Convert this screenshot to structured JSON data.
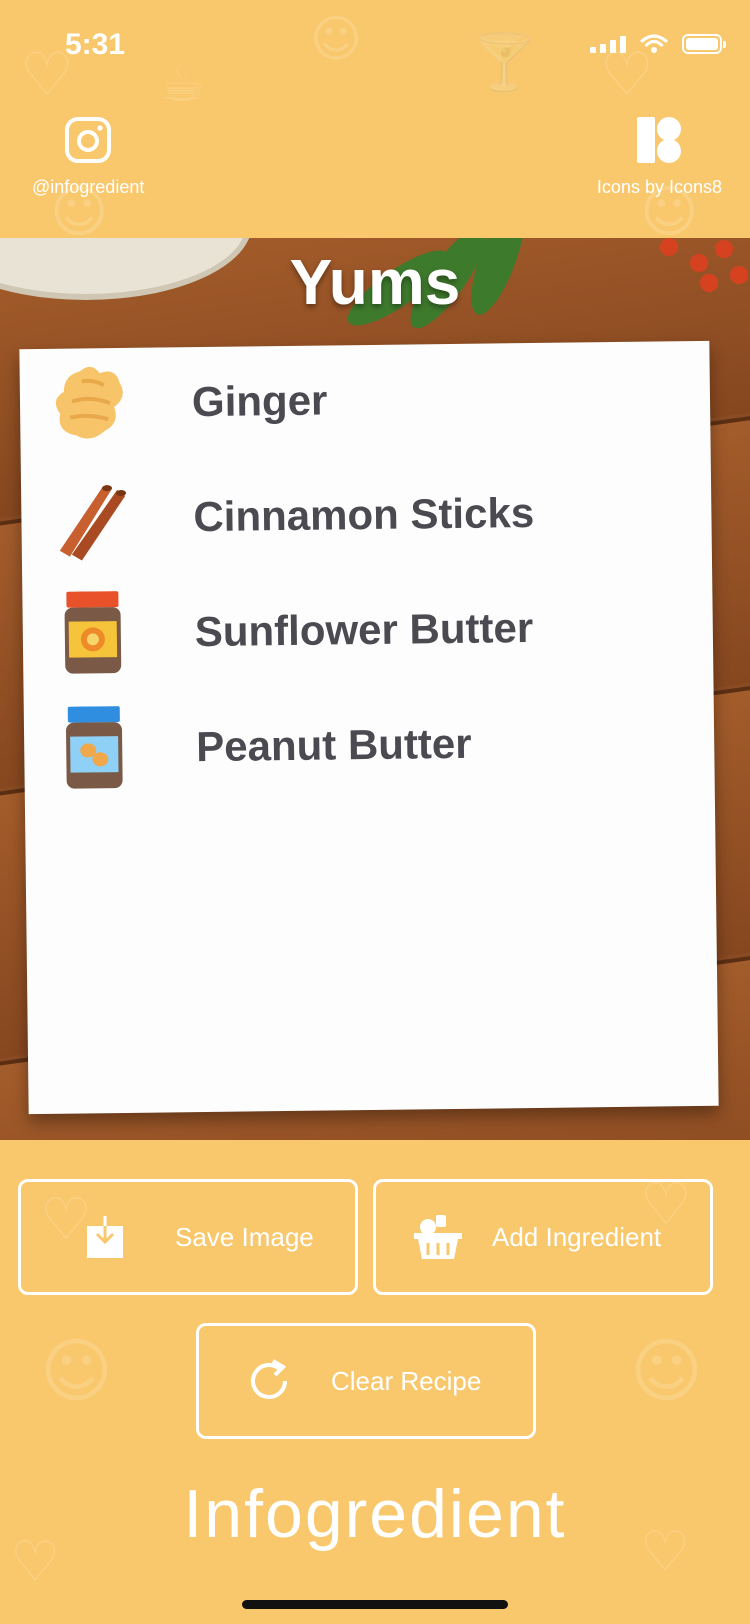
{
  "status_bar": {
    "time": "5:31"
  },
  "header": {
    "left_credit": {
      "label": "@infogredient",
      "icon": "instagram-icon"
    },
    "right_credit": {
      "label": "Icons by Icons8",
      "icon": "icons8-logo-icon"
    }
  },
  "recipe": {
    "title": "Yums",
    "ingredients": [
      {
        "name": "Ginger",
        "icon": "ginger-icon"
      },
      {
        "name": "Cinnamon Sticks",
        "icon": "cinnamon-sticks-icon"
      },
      {
        "name": "Sunflower Butter",
        "icon": "sunflower-butter-jar-icon"
      },
      {
        "name": "Peanut Butter",
        "icon": "peanut-butter-jar-icon"
      }
    ]
  },
  "actions": {
    "save_label": "Save Image",
    "add_label": "Add Ingredient",
    "clear_label": "Clear Recipe"
  },
  "footer": {
    "app_name": "Infogredient"
  },
  "colors": {
    "background": "#f9c86c",
    "text_dark": "#4a4a50",
    "white": "#ffffff"
  }
}
